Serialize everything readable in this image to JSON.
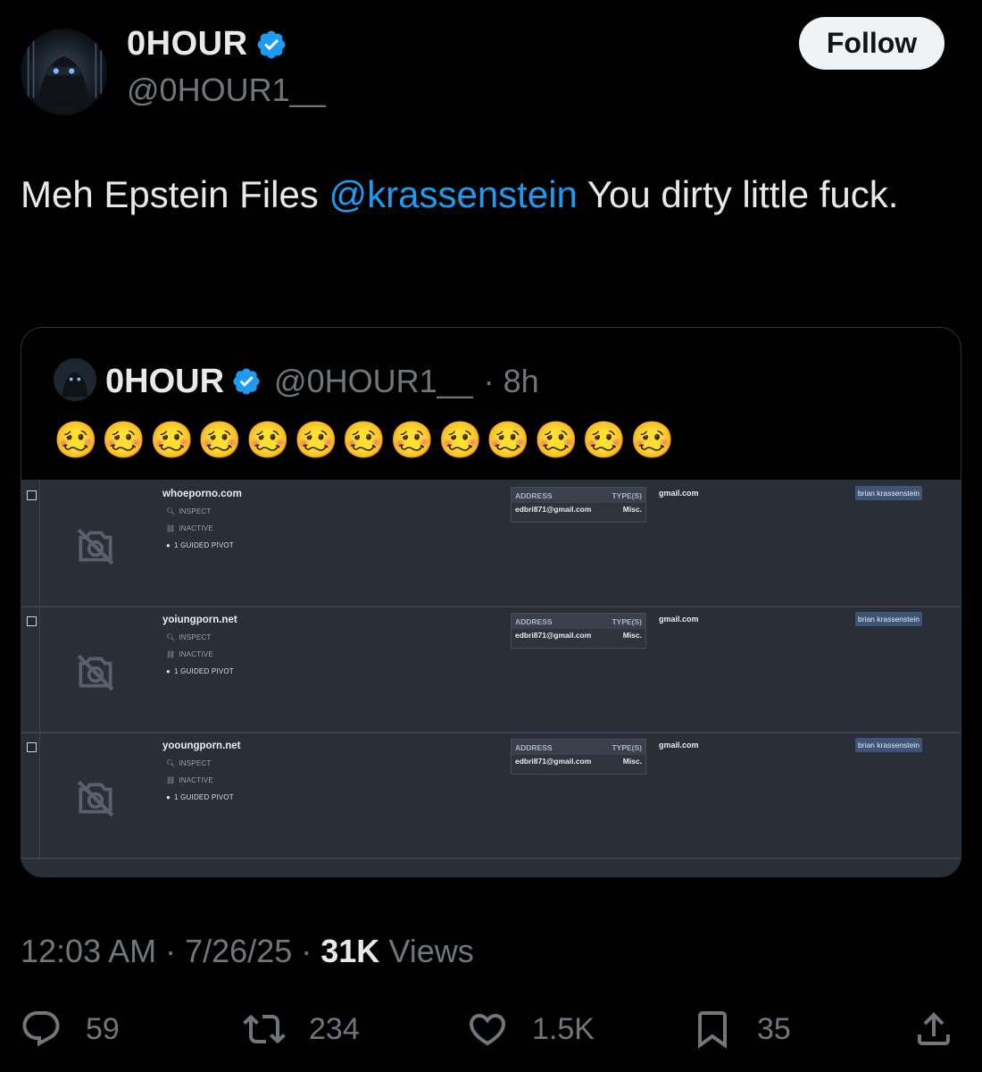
{
  "author": {
    "display_name": "0HOUR",
    "handle": "@0HOUR1__",
    "verified": true,
    "follow_label": "Follow"
  },
  "tweet": {
    "text_before": "Meh Epstein Files ",
    "mention": "@krassenstein",
    "text_after": " You dirty little fuck."
  },
  "quote": {
    "display_name": "0HOUR",
    "handle": "@0HOUR1__",
    "age": "· 8h",
    "emojis": "🥴🥴🥴🥴🥴🥴🥴🥴🥴🥴🥴🥴🥴",
    "screenshot_rows": [
      {
        "domain": "whoeporno.com",
        "inspect": "INSPECT",
        "status": "INACTIVE",
        "pivot": "1 GUIDED PIVOT",
        "address_header": "ADDRESS",
        "types_header": "TYPE(S)",
        "email": "edbri871@gmail.com",
        "type": "Misc.",
        "email_domain": "gmail.com",
        "tag": "brian krassenstein"
      },
      {
        "domain": "yoiungporn.net",
        "inspect": "INSPECT",
        "status": "INACTIVE",
        "pivot": "1 GUIDED PIVOT",
        "address_header": "ADDRESS",
        "types_header": "TYPE(S)",
        "email": "edbri871@gmail.com",
        "type": "Misc.",
        "email_domain": "gmail.com",
        "tag": "brian krassenstein"
      },
      {
        "domain": "yooungporn.net",
        "inspect": "INSPECT",
        "status": "INACTIVE",
        "pivot": "1 GUIDED PIVOT",
        "address_header": "ADDRESS",
        "types_header": "TYPE(S)",
        "email": "edbri871@gmail.com",
        "type": "Misc.",
        "email_domain": "gmail.com",
        "tag": "brian krassenstein"
      }
    ]
  },
  "meta": {
    "time": "12:03 AM",
    "date": "7/26/25",
    "views_count": "31K",
    "views_label": "Views"
  },
  "actions": {
    "replies": "59",
    "reposts": "234",
    "likes": "1.5K",
    "bookmarks": "35"
  },
  "icons": [
    "verified-badge-icon",
    "reply-icon",
    "repost-icon",
    "like-icon",
    "bookmark-icon",
    "share-icon",
    "no-photo-icon",
    "search-icon",
    "link-off-icon",
    "compass-icon"
  ],
  "colors": {
    "background": "#000000",
    "mention": "#1d9bf0",
    "verified": "#1d9bf0",
    "muted": "#71767b"
  }
}
